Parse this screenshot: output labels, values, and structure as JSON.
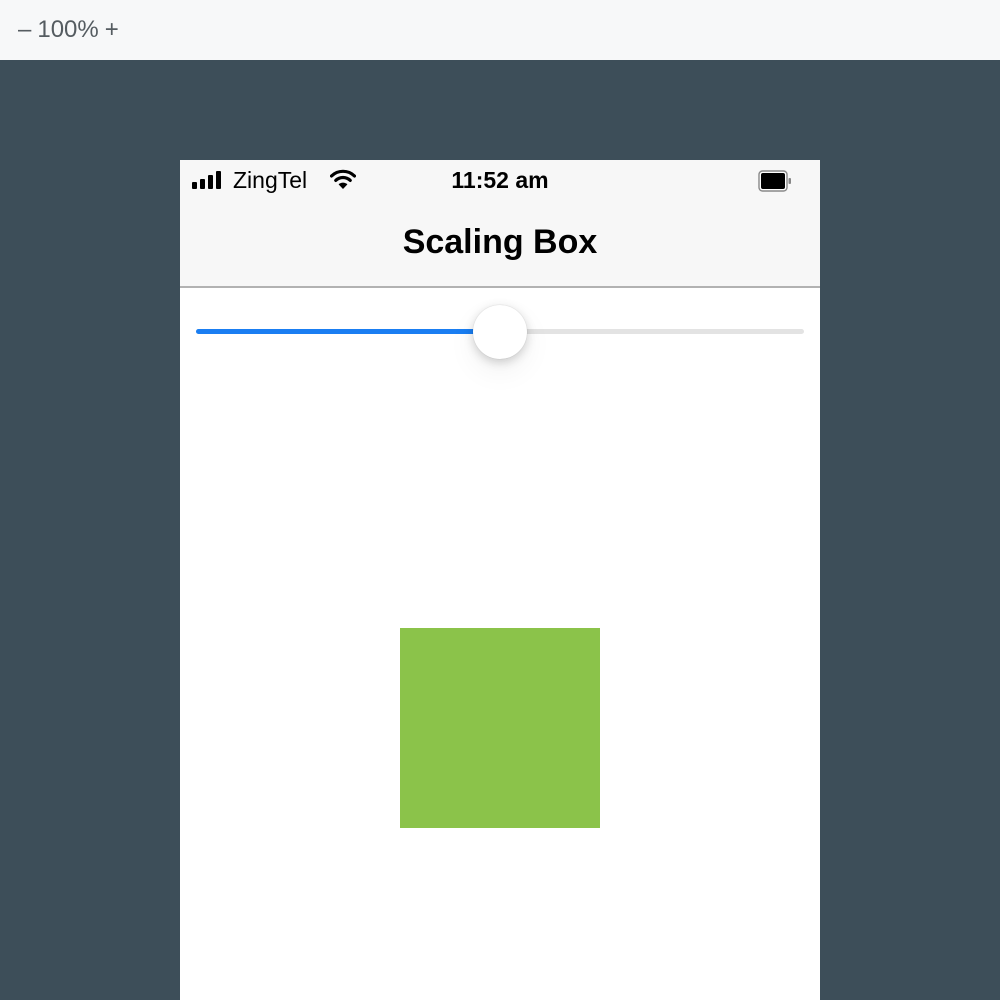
{
  "zoom": {
    "minus": "–",
    "level": "100%",
    "plus": "+"
  },
  "status_bar": {
    "carrier": "ZingTel",
    "time": "11:52 am",
    "signal_bars": 4
  },
  "nav": {
    "title": "Scaling Box"
  },
  "slider": {
    "value": 0.5
  },
  "colors": {
    "accent": "#1a7ef2",
    "box": "#8bc34a",
    "backdrop": "#3d4e59"
  },
  "icons": [
    "signal-icon",
    "wifi-icon",
    "battery-icon"
  ]
}
